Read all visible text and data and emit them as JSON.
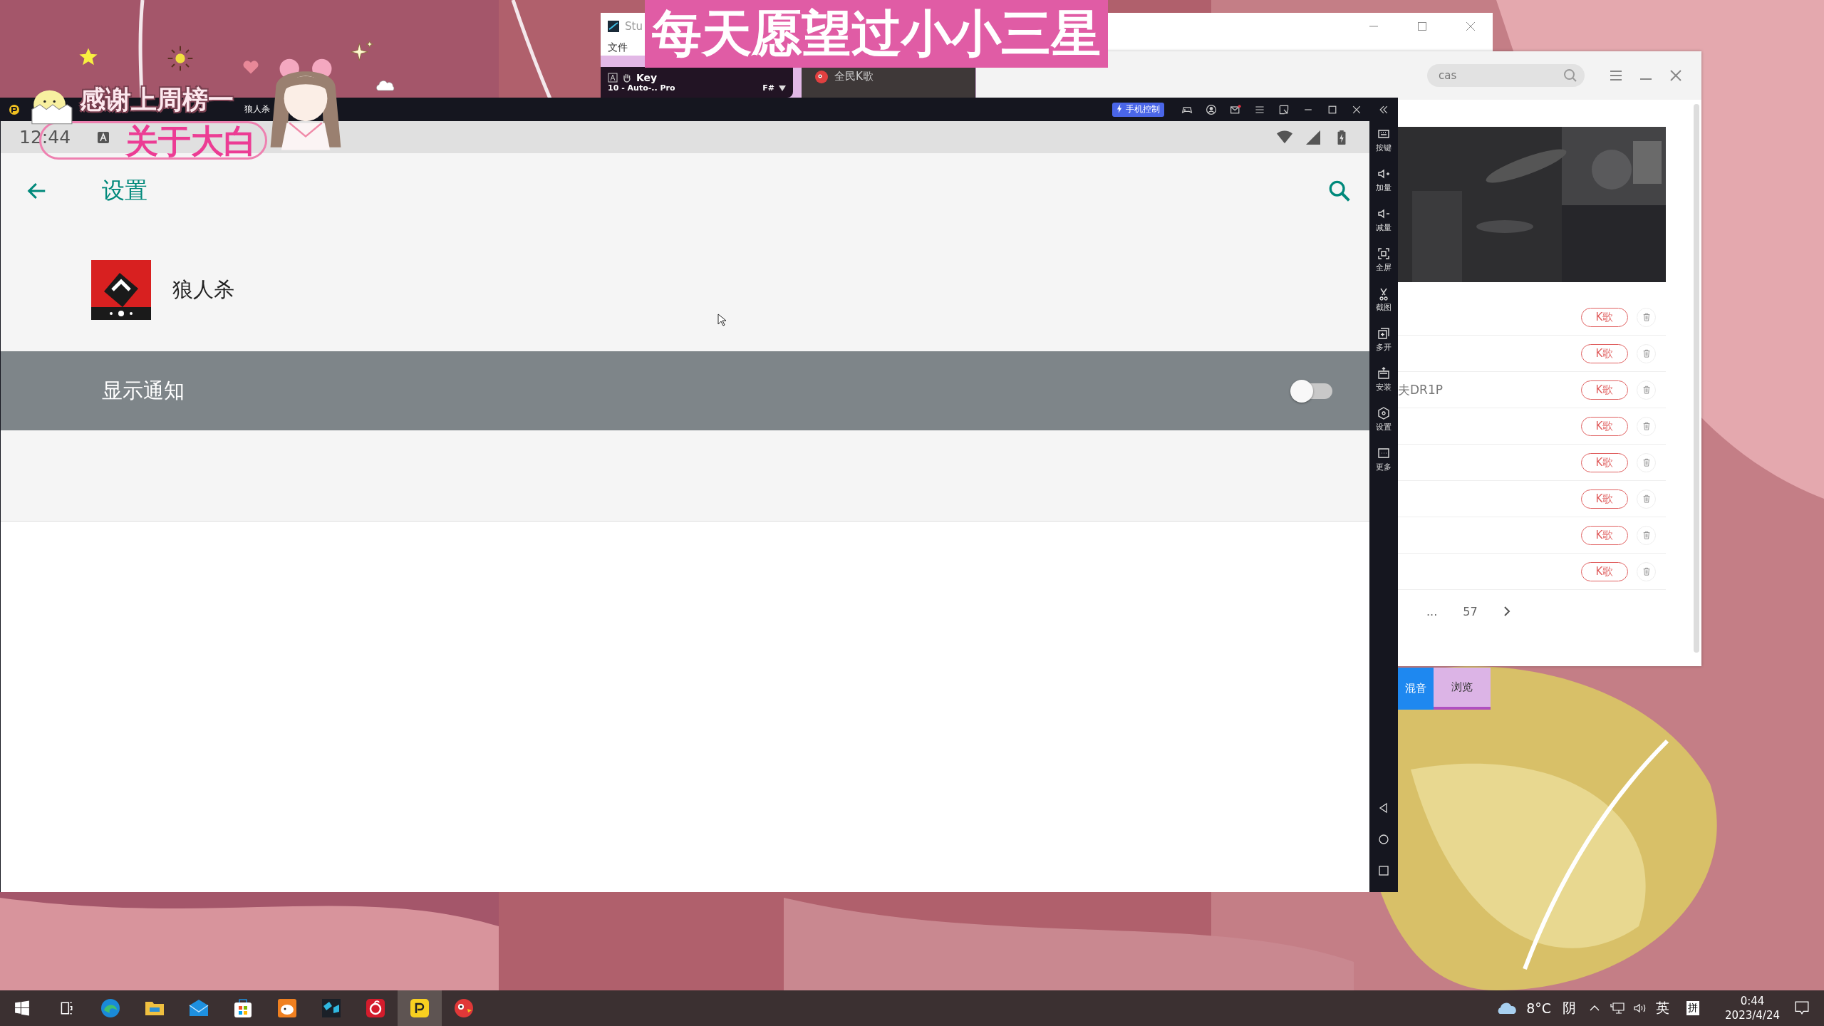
{
  "overlay": {
    "banner": "每天愿望过小小三星",
    "thanks": "感谢上周榜一",
    "name_tag": "关于大白"
  },
  "studio_window": {
    "title": "Stu",
    "menu": [
      "文件"
    ],
    "key_panel": {
      "label": "Key",
      "preset": "10 - Auto-.. Pro",
      "key": "F#"
    },
    "tab": "全民K歌"
  },
  "music_window": {
    "search": {
      "value": "cas"
    },
    "rows": [
      {
        "action": "K歌"
      },
      {
        "action": "K歌"
      },
      {
        "title": "夫DR1P",
        "action": "K歌"
      },
      {
        "action": "K歌"
      },
      {
        "action": "K歌"
      },
      {
        "action": "K歌"
      },
      {
        "action": "K歌"
      },
      {
        "action": "K歌"
      }
    ],
    "pagination": [
      "...",
      "57"
    ],
    "buttons": [
      {
        "label": "混音",
        "color": "#1e88f0"
      },
      {
        "label": "浏览",
        "color": "#dcb4e6"
      }
    ]
  },
  "emulator": {
    "tabs": [
      {
        "label": "狼人杀",
        "selected": true
      }
    ],
    "phone_control": "手机控制",
    "status_bar": {
      "time": "12:44"
    },
    "app_bar": {
      "title": "设置"
    },
    "app": {
      "name": "狼人杀"
    },
    "notification": {
      "label": "显示通知",
      "on": false
    },
    "sidebar": [
      {
        "label": "按键"
      },
      {
        "label": "加量"
      },
      {
        "label": "减量"
      },
      {
        "label": "全屏"
      },
      {
        "label": "截图"
      },
      {
        "label": "多开"
      },
      {
        "label": "安装"
      },
      {
        "label": "设置"
      },
      {
        "label": "更多"
      }
    ]
  },
  "taskbar": {
    "apps": [
      {
        "selected": false
      },
      {
        "selected": false
      },
      {
        "selected": false
      },
      {
        "selected": false
      },
      {
        "selected": false
      },
      {
        "selected": false
      },
      {
        "selected": false
      },
      {
        "selected": true
      },
      {
        "selected": false
      }
    ],
    "weather": {
      "temp": "8°C",
      "sky": "阴"
    },
    "ime": [
      "英",
      "拼"
    ],
    "time": "0:44",
    "date": "2023/4/24"
  }
}
